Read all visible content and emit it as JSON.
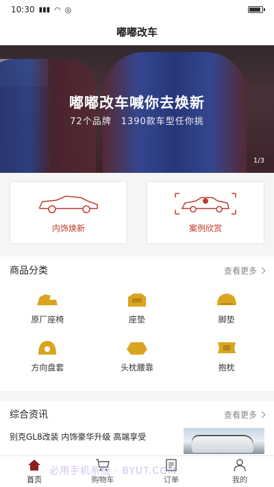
{
  "status_bar": {
    "time": "10:30",
    "signal_text": "⁵⁶ᴳ"
  },
  "header": {
    "title": "嘟嘟改车"
  },
  "banner": {
    "headline": "嘟嘟改车喊你去焕新",
    "subline": "72个品牌　1390款车型任你挑",
    "pager": "1/3"
  },
  "features": [
    {
      "label": "内饰焕新",
      "icon": "car-outline-icon"
    },
    {
      "label": "案例欣赏",
      "icon": "car-framed-icon"
    }
  ],
  "category": {
    "title": "商品分类",
    "more": "查看更多",
    "items": [
      {
        "label": "原厂座椅",
        "icon": "seat-icon"
      },
      {
        "label": "座垫",
        "icon": "seat-cushion-icon"
      },
      {
        "label": "脚垫",
        "icon": "floor-mat-icon"
      },
      {
        "label": "方向盘套",
        "icon": "steering-cover-icon"
      },
      {
        "label": "头枕腰靠",
        "icon": "headrest-icon"
      },
      {
        "label": "抱枕",
        "icon": "pillow-icon"
      }
    ]
  },
  "news": {
    "title": "综合资讯",
    "more": "查看更多",
    "headline": "别克GL8改装 内饰豪华升级 高端享受"
  },
  "watermark": "必用手机系统 · BYUT.COM",
  "tabbar": [
    {
      "label": "首页",
      "icon": "home-icon",
      "active": true
    },
    {
      "label": "购物车",
      "icon": "cart-icon",
      "active": false
    },
    {
      "label": "订单",
      "icon": "order-icon",
      "active": false
    },
    {
      "label": "我的",
      "icon": "user-icon",
      "active": false
    }
  ],
  "colors": {
    "accent": "#c0392b",
    "gold": "#d9a520"
  }
}
